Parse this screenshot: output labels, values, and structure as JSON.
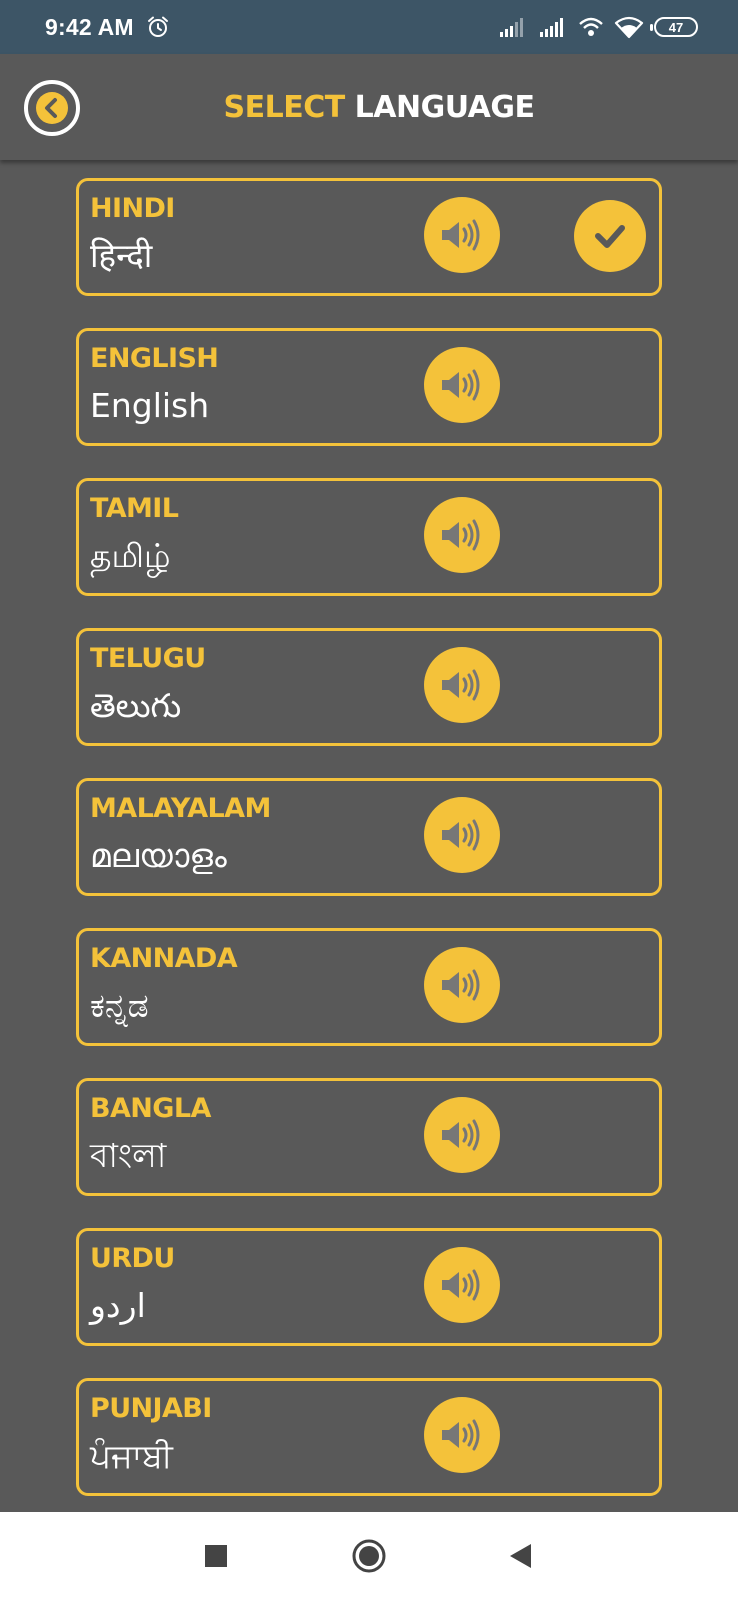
{
  "status_bar": {
    "time": "9:42 AM",
    "battery": "47",
    "icons": [
      "alarm-icon",
      "signal-icon",
      "signal-icon",
      "hotspot-icon",
      "wifi-icon",
      "battery-icon"
    ]
  },
  "header": {
    "title_part1": "SELECT",
    "title_part2": "LANGUAGE",
    "back_icon": "chevron-left-icon"
  },
  "languages": [
    {
      "name": "HINDI",
      "native": "हिन्दी",
      "selected": true
    },
    {
      "name": "ENGLISH",
      "native": "English",
      "selected": false
    },
    {
      "name": "TAMIL",
      "native": "தமிழ்",
      "selected": false
    },
    {
      "name": "TELUGU",
      "native": "తెలుగు",
      "selected": false
    },
    {
      "name": "MALAYALAM",
      "native": "മലയാളം",
      "selected": false
    },
    {
      "name": "KANNADA",
      "native": "ಕನ್ನಡ",
      "selected": false
    },
    {
      "name": "BANGLA",
      "native": "বাংলা",
      "selected": false
    },
    {
      "name": "URDU",
      "native": "اردو",
      "selected": false
    },
    {
      "name": "PUNJABI",
      "native": "ਪੰਜਾਬੀ",
      "selected": false
    }
  ],
  "nav_bar": {
    "icons": [
      "recents-square-icon",
      "home-circle-icon",
      "back-triangle-icon"
    ]
  },
  "colors": {
    "accent": "#f4c23a",
    "background": "#595959",
    "status_bar": "#3d5566"
  }
}
